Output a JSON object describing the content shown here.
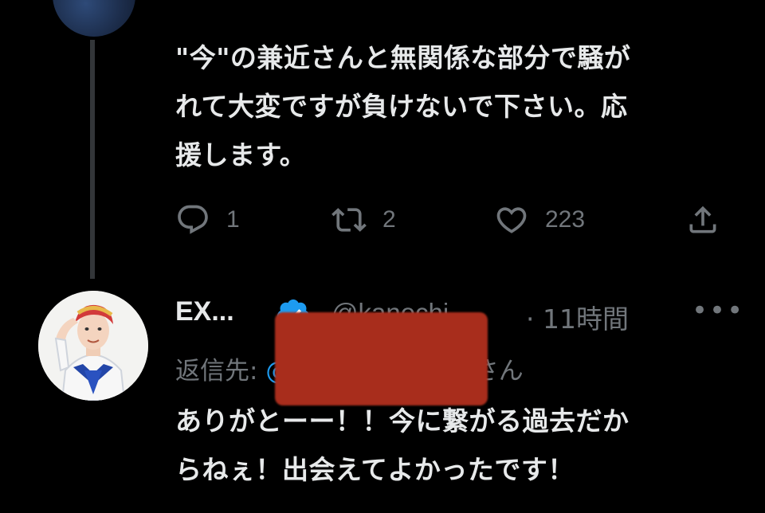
{
  "parent_tweet": {
    "text_lines": [
      "\"今\"の兼近さんと無関係な部分で騒が",
      "れて大変ですが負けないで下さい。応",
      "援します。"
    ],
    "actions": {
      "reply_count": "1",
      "retweet_count": "2",
      "like_count": "223"
    }
  },
  "reply_tweet": {
    "display_name": "EX...",
    "handle": "@kanechi...",
    "time": "· 11時間",
    "more": "•••",
    "reply_to_label": "返信先: ",
    "reply_to_at": "@",
    "reply_to_suffix": "6さん",
    "text_lines": [
      "ありがとーー！！今に繋がる過去だか",
      "らねぇ！出会えてよかったです！"
    ]
  },
  "colors": {
    "background": "#000000",
    "text": "#e7e9ea",
    "muted": "#71767b",
    "accent": "#1d9bf0",
    "redaction": "#a82d1c"
  },
  "icons": [
    "reply-icon",
    "retweet-icon",
    "like-icon",
    "share-icon",
    "verified-badge-icon",
    "more-icon"
  ]
}
